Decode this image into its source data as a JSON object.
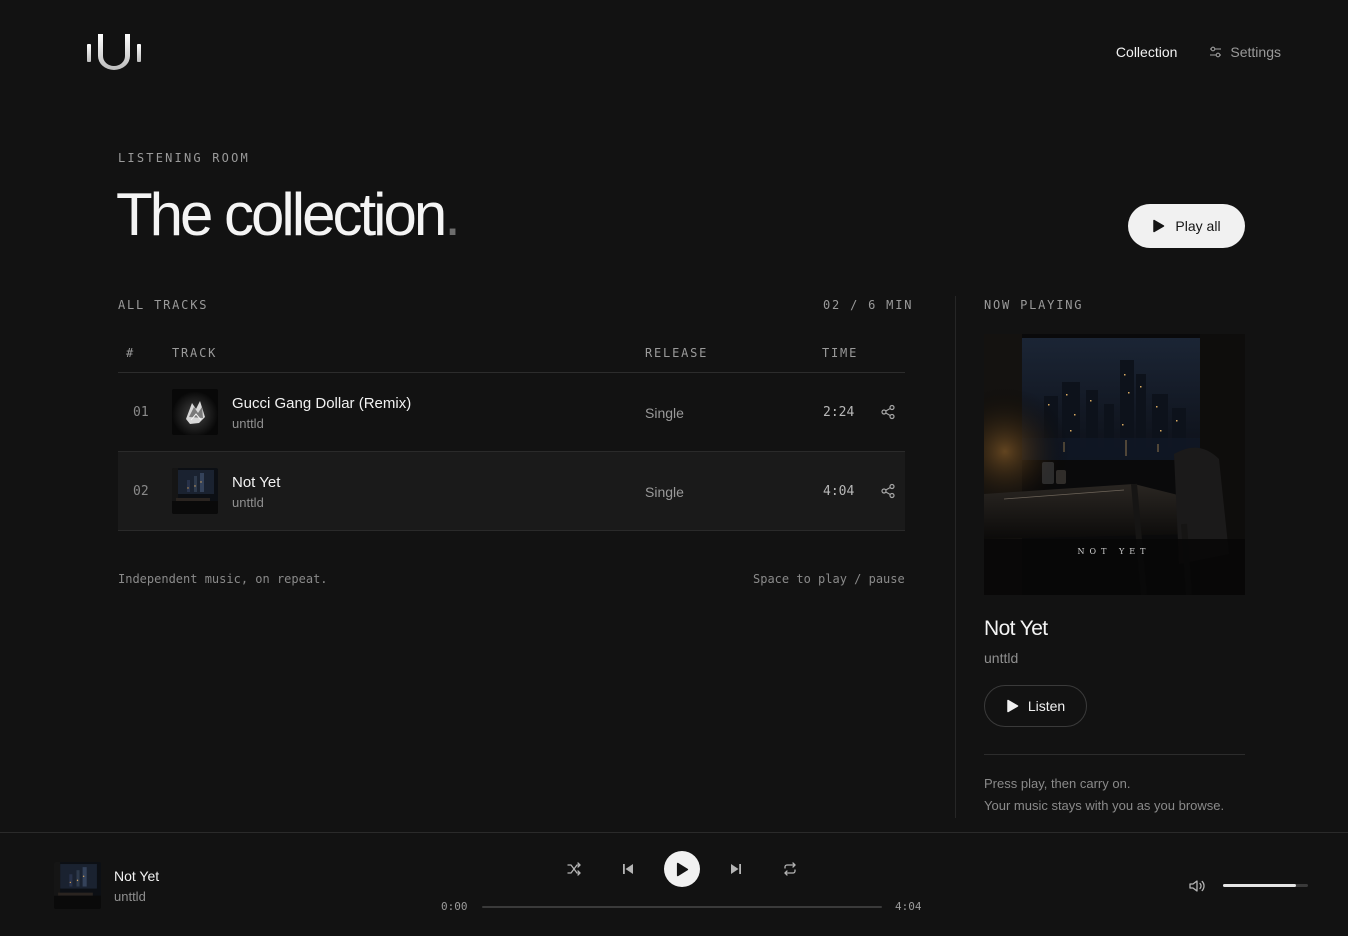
{
  "nav": {
    "collection": "Collection",
    "settings": "Settings"
  },
  "hero": {
    "eyebrow": "LISTENING ROOM",
    "title": "The collection",
    "title_dot": ".",
    "play_all": "Play all"
  },
  "tracks_section": {
    "label": "ALL TRACKS",
    "summary": "02 / 6 MIN",
    "headers": {
      "num": "#",
      "track": "TRACK",
      "release": "RELEASE",
      "time": "TIME"
    },
    "rows": [
      {
        "num": "01",
        "title": "Gucci Gang Dollar (Remix)",
        "artist": "unttld",
        "release": "Single",
        "time": "2:24",
        "active": false
      },
      {
        "num": "02",
        "title": "Not Yet",
        "artist": "unttld",
        "release": "Single",
        "time": "4:04",
        "active": true
      }
    ],
    "footer_left": "Independent music, on repeat.",
    "footer_right": "Space to play / pause"
  },
  "now_playing": {
    "label": "NOW PLAYING",
    "title": "Not Yet",
    "artist": "unttld",
    "cover_text": "NOT YET",
    "listen": "Listen",
    "note_line1": "Press play, then carry on.",
    "note_line2": "Your music stays with you as you browse."
  },
  "player": {
    "title": "Not Yet",
    "artist": "unttld",
    "current_time": "0:00",
    "total_time": "4:04",
    "progress": 0,
    "volume": 0.86
  },
  "colors": {
    "background": "#121212",
    "accent": "#f1f1f1",
    "muted": "#9a9a9a"
  },
  "icons": [
    "logo-icon",
    "settings-sliders-icon",
    "play-icon",
    "share-icon",
    "shuffle-icon",
    "previous-icon",
    "next-icon",
    "repeat-icon",
    "volume-icon"
  ]
}
